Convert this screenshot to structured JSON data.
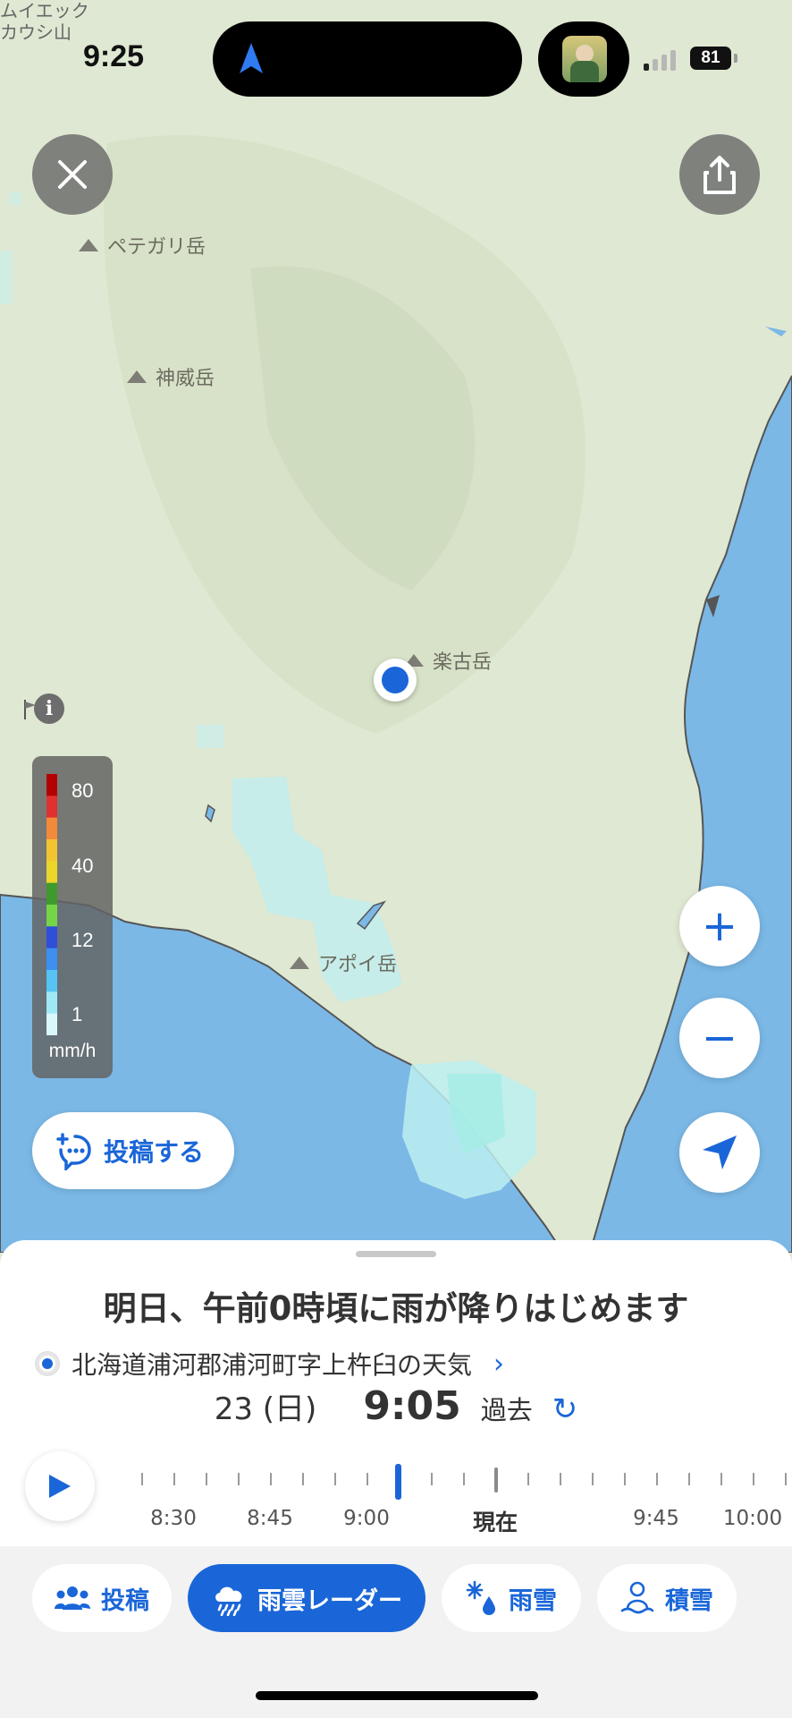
{
  "status_bar": {
    "time": "9:25",
    "battery": "81",
    "top_label_line1": "ムイエック",
    "top_label_line2": "カウシ山"
  },
  "map": {
    "labels": [
      {
        "name": "peak-petegari",
        "text": "ペテガリ岳"
      },
      {
        "name": "peak-kamui",
        "text": "神威岳"
      },
      {
        "name": "peak-rakko",
        "text": "楽古岳"
      },
      {
        "name": "peak-apoi",
        "text": "アポイ岳"
      }
    ],
    "colors": {
      "land": "#dfe8d2",
      "sea": "#7bb8e6",
      "rain_light": "#bdeff0",
      "accent": "#1a66d8"
    }
  },
  "legend": {
    "values": [
      "80",
      "40",
      "12",
      "1"
    ],
    "unit": "mm/h",
    "colors": [
      "#b30000",
      "#e03030",
      "#f28a3a",
      "#f3c431",
      "#ead72a",
      "#3f9a2d",
      "#76d447",
      "#2f4fd8",
      "#3d8ff2",
      "#56c3f4",
      "#9fe9f7",
      "#d8f8fb"
    ]
  },
  "buttons": {
    "close_icon": "close-icon",
    "share_icon": "share-icon",
    "zoom_in": "+",
    "zoom_out": "−",
    "post_label": "投稿する"
  },
  "sheet": {
    "forecast": "明日、午前0時頃に雨が降りはじめます",
    "location": "北海道浦河郡浦河町字上杵臼の天気",
    "date": "23 (日)",
    "time": "9:05",
    "status": "過去",
    "timeline_labels": [
      {
        "text": "8:30"
      },
      {
        "text": "8:45"
      },
      {
        "text": "9:00"
      },
      {
        "text": "現在"
      },
      {
        "text": "9:45"
      },
      {
        "text": "10:00"
      }
    ]
  },
  "tabs": [
    {
      "name": "tab-posts",
      "label": "投稿",
      "active": false
    },
    {
      "name": "tab-rain-radar",
      "label": "雨雲レーダー",
      "active": true
    },
    {
      "name": "tab-rain-snow",
      "label": "雨雪",
      "active": false
    },
    {
      "name": "tab-snow-depth",
      "label": "積雪",
      "active": false
    }
  ]
}
